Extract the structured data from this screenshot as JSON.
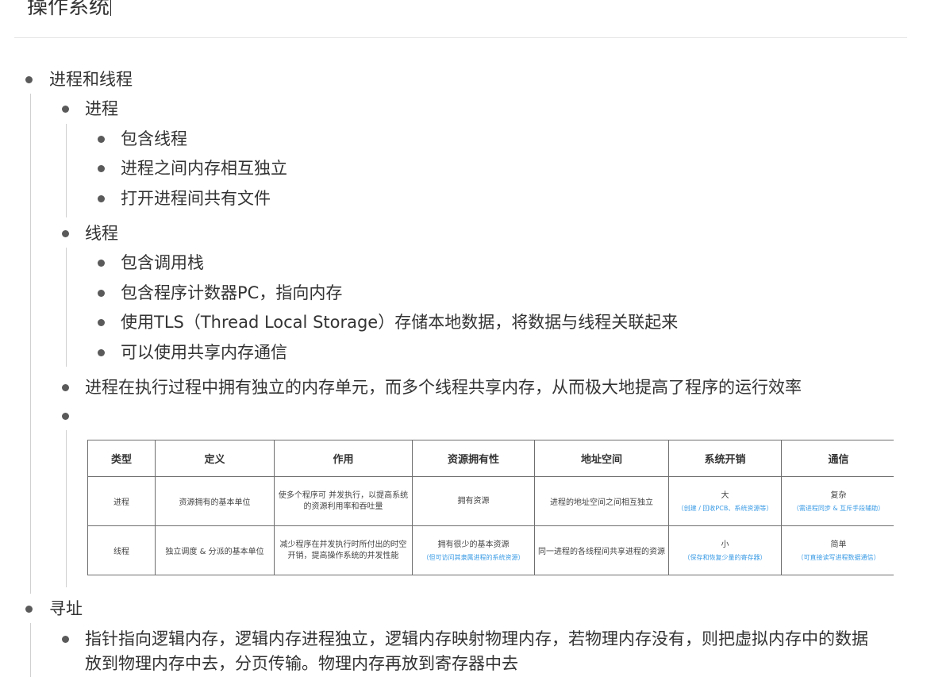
{
  "doc": {
    "title": "操作系统"
  },
  "outline": {
    "l1_processes_threads": "进程和线程",
    "l2_process": "进程",
    "l3_p1": "包含线程",
    "l3_p2": "进程之间内存相互独立",
    "l3_p3": "打开进程间共有文件",
    "l2_thread": "线程",
    "l3_t1": "包含调用栈",
    "l3_t2": "包含程序计数器PC，指向内存",
    "l3_t3": "使用TLS（Thread Local Storage）存储本地数据，将数据与线程关联起来",
    "l3_t4": "可以使用共享内存通信",
    "l2_summary": "进程在执行过程中拥有独立的内存单元，而多个线程共享内存，从而极大地提高了程序的运行效率",
    "l1_addressing": "寻址",
    "l2_addr_line1": "指针指向逻辑内存，逻辑内存进程独立，逻辑内存映射物理内存，若物理内存没有，则把虚拟内存中的数据",
    "l2_addr_line2": "放到物理内存中去，分页传输。物理内存再放到寄存器中去"
  },
  "table": {
    "headers": [
      "类型",
      "定义",
      "作用",
      "资源拥有性",
      "地址空间",
      "系统开销",
      "通信"
    ],
    "rows": [
      {
        "type": "进程",
        "definition": "资源拥有的基本单位",
        "role": "使多个程序可 并发执行，以提高系统的资源利用率和吞吐量",
        "resources": "拥有资源",
        "resources_note": "",
        "address": "进程的地址空间之间相互独立",
        "overhead": "大",
        "overhead_note": "（创建 / 回收PCB、系统资源等）",
        "comm": "复杂",
        "comm_note": "（需进程同步 & 互斥手段辅助）"
      },
      {
        "type": "线程",
        "definition": "独立调度 & 分派的基本单位",
        "role": "减少程序在并发执行时所付出的时空开销，提高操作系统的并发性能",
        "resources": "拥有很少的基本资源",
        "resources_note": "（但可访问其隶属进程的系统资源）",
        "address": "同一进程的各线程间共享进程的资源",
        "overhead": "小",
        "overhead_note": "（保存和恢复少量的寄存器）",
        "comm": "简单",
        "comm_note": "（可直接读写进程数据通信）"
      }
    ]
  }
}
